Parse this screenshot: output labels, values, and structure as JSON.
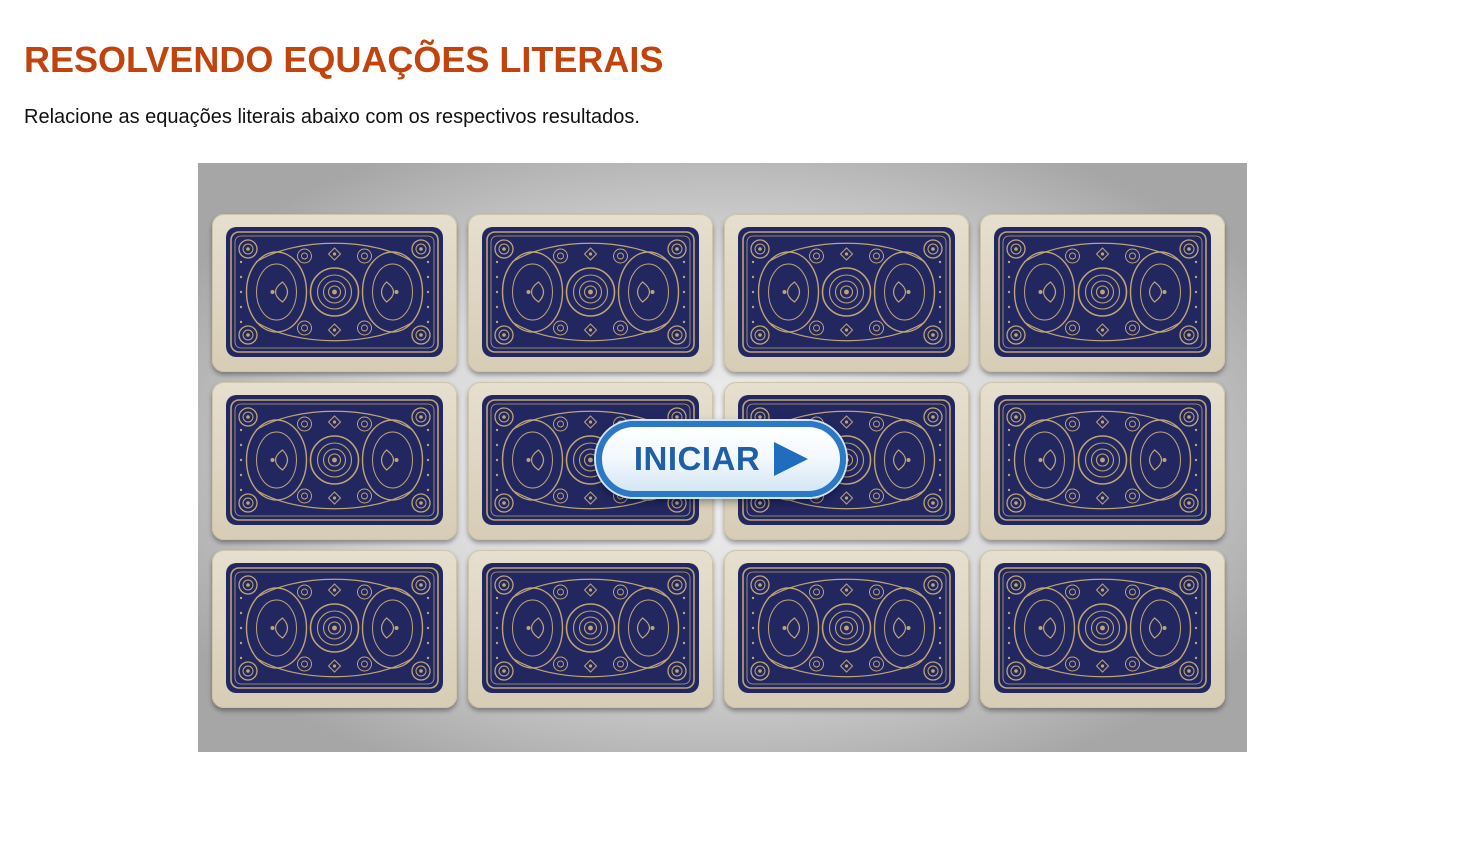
{
  "page": {
    "title": "RESOLVENDO EQUAÇÕES LITERAIS",
    "subtitle": "Relacione as equações literais abaixo com os respectivos resultados."
  },
  "game": {
    "rows": 3,
    "columns": 4,
    "card_count": 12,
    "card_state": "face-down",
    "start_button_label": "INICIAR",
    "start_icon": "play-icon"
  },
  "colors": {
    "title": "#c1440e",
    "card_back": "#232760",
    "card_ornament": "#bda477",
    "card_border": "#ddd5c2",
    "button_border": "#2b78c4",
    "button_text": "#1f5ea8"
  }
}
